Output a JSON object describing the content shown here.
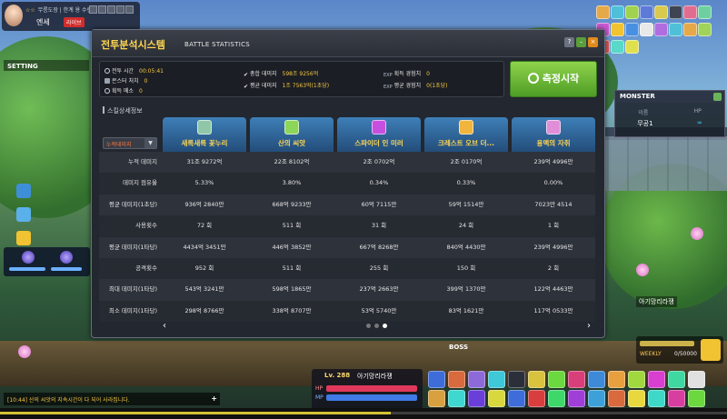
{
  "player_top": {
    "line1_stars": "☆☆",
    "line1_text": "무릉도장 | 한계 용 수련장",
    "name": "엔세",
    "live_tag": "라이브"
  },
  "left": {
    "setting_tab": "SETTING"
  },
  "monster_panel": {
    "title": "MONSTER",
    "col_name": "이름",
    "col_hp": "HP",
    "monster_name": "무공1",
    "monster_hp": "∞"
  },
  "right_quest": {
    "character_name": "아기망리라쟁",
    "weekly_label": "WEEKLY",
    "weekly_value": "0/50000"
  },
  "hud": {
    "boss_label": "BOSS",
    "level": "Lv. 288",
    "char_name": "아기망리라쟁",
    "hp_label": "HP",
    "mp_label": "MP",
    "chat_message": "[10:44] 산의 씨앗의 지속시간이 다 되어 사라집니다."
  },
  "battle_window": {
    "title": "전투분석시스템",
    "subtitle": "BATTLE STATISTICS",
    "help_btn": "?",
    "stats": {
      "battle_time_label": "전투 시간",
      "battle_time_value": "00:05:41",
      "monster_kill_label": "몬스터 처치",
      "monster_kill_value": "0",
      "meso_label": "획득 메소",
      "meso_value": "0",
      "total_damage_label": "총합 데미지",
      "total_damage_value": "598조 9256억",
      "avg_damage_label": "평균 데미지",
      "avg_damage_value": "1조 7563억(1초당)",
      "exp_label": "획득 경험치",
      "exp_value": "0",
      "avg_exp_label": "평균 경험치",
      "avg_exp_value": "0(1초당)"
    },
    "measure_button": "측정시작",
    "skill_section": "스킬상세정보",
    "sort_select": "누적데미지",
    "row_labels": [
      "누적 데미지",
      "데미지 점유율",
      "평균 데미지(1초당)",
      "사용횟수",
      "평균 데미지(1타당)",
      "공격횟수",
      "최대 데미지(1타당)",
      "최소 데미지(1타당)"
    ],
    "skills": [
      {
        "name": "새록새록 꽃누리",
        "icon": "flower-skill-icon",
        "color": "#8fc7a8",
        "values": [
          "31조 9272억",
          "5.33%",
          "936억 2840만",
          "72 회",
          "4434억 3451만",
          "952 회",
          "543억 3241만",
          "298억 8766만"
        ]
      },
      {
        "name": "산의 씨앗",
        "icon": "seed-skill-icon",
        "color": "#8cd65a",
        "values": [
          "22조 8102억",
          "3.80%",
          "668억 9233만",
          "511 회",
          "446억 3852만",
          "511 회",
          "598억 1865만",
          "338억 8707만"
        ]
      },
      {
        "name": "스파이더 인 미러",
        "icon": "spider-skill-icon",
        "color": "#c74fe0",
        "values": [
          "2조 0702억",
          "0.34%",
          "60억 7115만",
          "31 회",
          "667억 8268만",
          "255 회",
          "237억 2663만",
          "53억 5740만"
        ]
      },
      {
        "name": "크레스트 오브 더...",
        "icon": "crest-skill-icon",
        "color": "#f1b43c",
        "values": [
          "2조 0170억",
          "0.33%",
          "59억 1514만",
          "24 회",
          "840억 4430만",
          "150 회",
          "399억 1370만",
          "83억 1621만"
        ]
      },
      {
        "name": "용맥의 자취",
        "icon": "dragon-vein-skill-icon",
        "color": "#e08ed8",
        "values": [
          "239억 4996만",
          "0.00%",
          "7023만 4514",
          "1 회",
          "239억 4996만",
          "2 회",
          "122억 4463만",
          "117억 0533만"
        ]
      }
    ],
    "nav_prev": "‹",
    "nav_next": "›"
  }
}
